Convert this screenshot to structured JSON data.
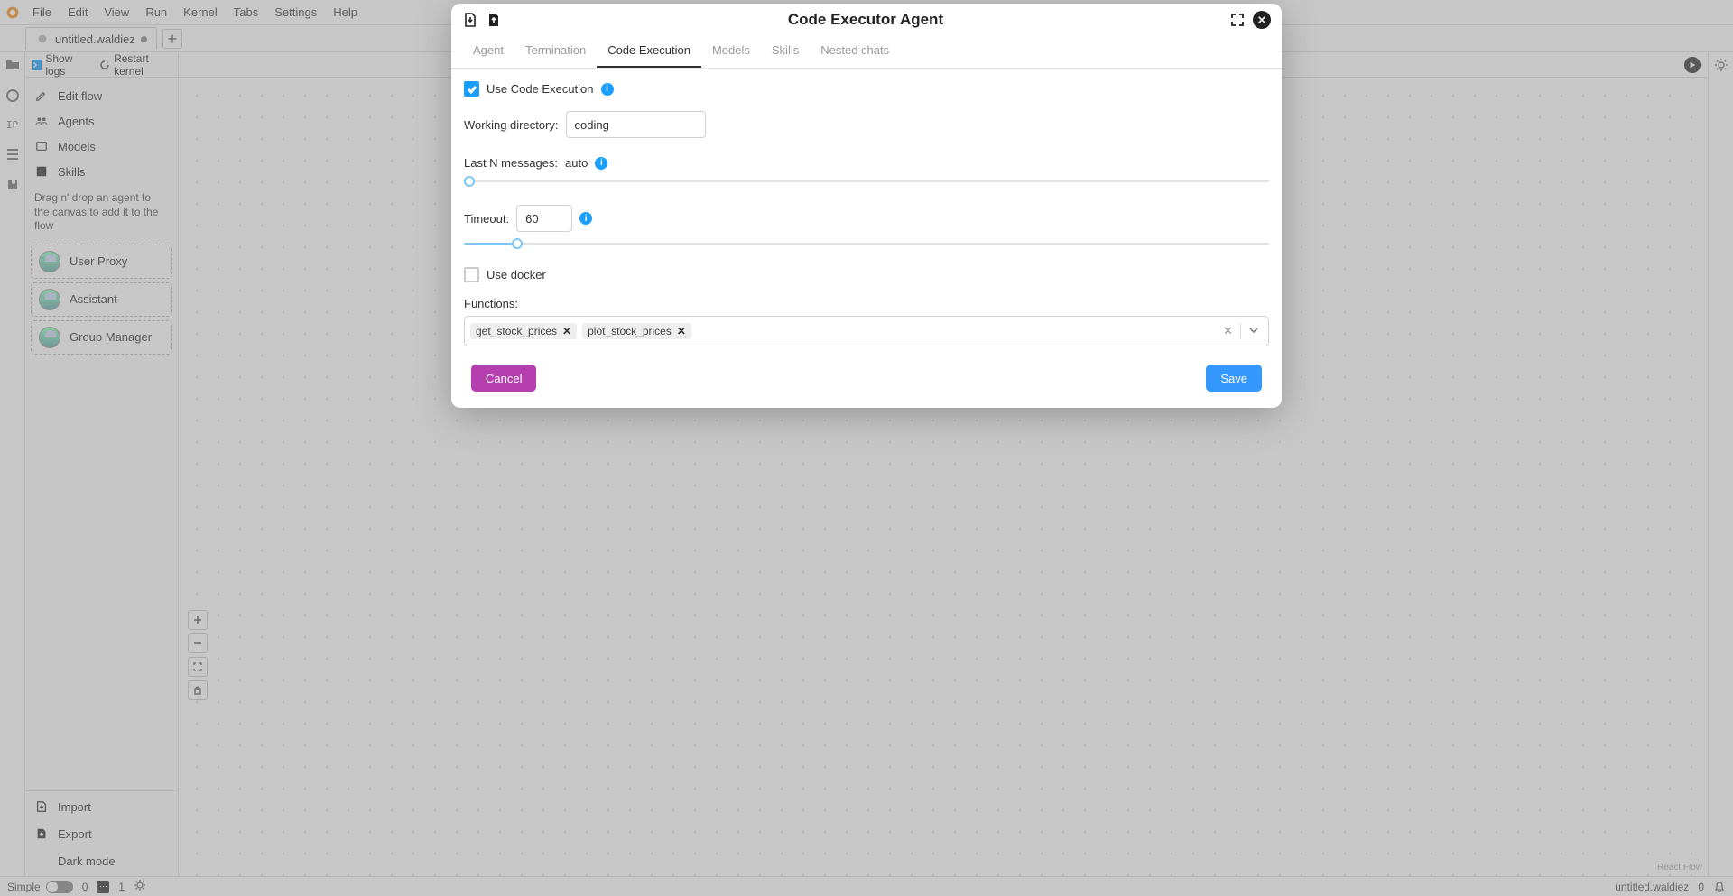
{
  "menubar": [
    "File",
    "Edit",
    "View",
    "Run",
    "Kernel",
    "Tabs",
    "Settings",
    "Help"
  ],
  "file_tab": {
    "name": "untitled.waldiez"
  },
  "sidebar": {
    "show_logs": "Show logs",
    "restart_kernel": "Restart kernel",
    "items": [
      {
        "label": "Edit flow"
      },
      {
        "label": "Agents"
      },
      {
        "label": "Models"
      },
      {
        "label": "Skills"
      }
    ],
    "hint": "Drag n' drop an agent to the canvas to add it to the flow",
    "agents": [
      {
        "label": "User Proxy"
      },
      {
        "label": "Assistant"
      },
      {
        "label": "Group Manager"
      }
    ],
    "import": "Import",
    "export": "Export",
    "dark_mode": "Dark mode"
  },
  "canvas": {
    "react_flow_credit": "React Flow"
  },
  "statusbar": {
    "simple": "Simple",
    "zero": "0",
    "one": "1",
    "filename": "untitled.waldiez",
    "notif": "0"
  },
  "modal": {
    "title": "Code Executor Agent",
    "tabs": [
      "Agent",
      "Termination",
      "Code Execution",
      "Models",
      "Skills",
      "Nested chats"
    ],
    "use_code_exec": "Use Code Execution",
    "working_dir_label": "Working directory:",
    "working_dir_value": "coding",
    "last_n_label": "Last N messages:",
    "last_n_value": "auto",
    "timeout_label": "Timeout:",
    "timeout_value": "60",
    "use_docker": "Use docker",
    "functions_label": "Functions:",
    "functions": [
      "get_stock_prices",
      "plot_stock_prices"
    ],
    "cancel": "Cancel",
    "save": "Save"
  }
}
